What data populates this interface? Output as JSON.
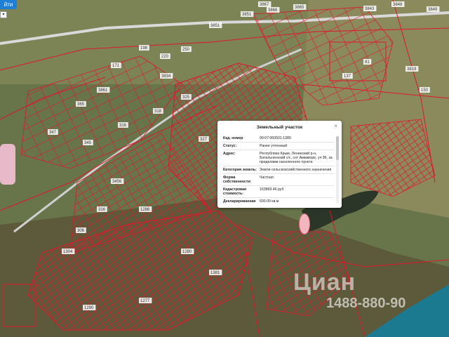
{
  "toolbar": {
    "button_label": "йти"
  },
  "popup": {
    "title": "Земельный участок",
    "close_icon": "close-icon",
    "rows": [
      {
        "key": "Кад. номер",
        "value": "90:07:060501:1389"
      },
      {
        "key": "Статус:",
        "value": "Ранее учтенный"
      },
      {
        "key": "Адрес:",
        "value": "Республика Крым, Ленинский р-н, Батальненский с/с, снт Акваморе, уч 96, за пределами населенного пункта"
      },
      {
        "key": "Категория земель:",
        "value": "Земли сельскохозяйственного назначения"
      },
      {
        "key": "Форма собственности:",
        "value": "Частная"
      },
      {
        "key": "Кадастровая стоимость:",
        "value": "163869.46 руб"
      },
      {
        "key": "Декларированная",
        "value": "600.00 кв.м"
      }
    ]
  },
  "watermark": {
    "brand": "Циан",
    "phone": "1488-880-90"
  },
  "colors": {
    "parcel_border": "#e0162b",
    "road": "#dcdcdc",
    "sea": "#1b7a8f",
    "lake": "#2d3a2a",
    "land": "#6a7742"
  },
  "plot_labels": [
    "3867",
    "3851",
    "3866",
    "3865",
    "3843",
    "3848",
    "3849",
    "3851",
    "250",
    "220",
    "198",
    "171",
    "3834",
    "3861",
    "365",
    "347",
    "345",
    "316",
    "318",
    "325",
    "327",
    "3456",
    "316",
    "306",
    "1304",
    "1286",
    "1280",
    "1381",
    "1290",
    "1277",
    "3819",
    "150",
    "81",
    "137"
  ]
}
